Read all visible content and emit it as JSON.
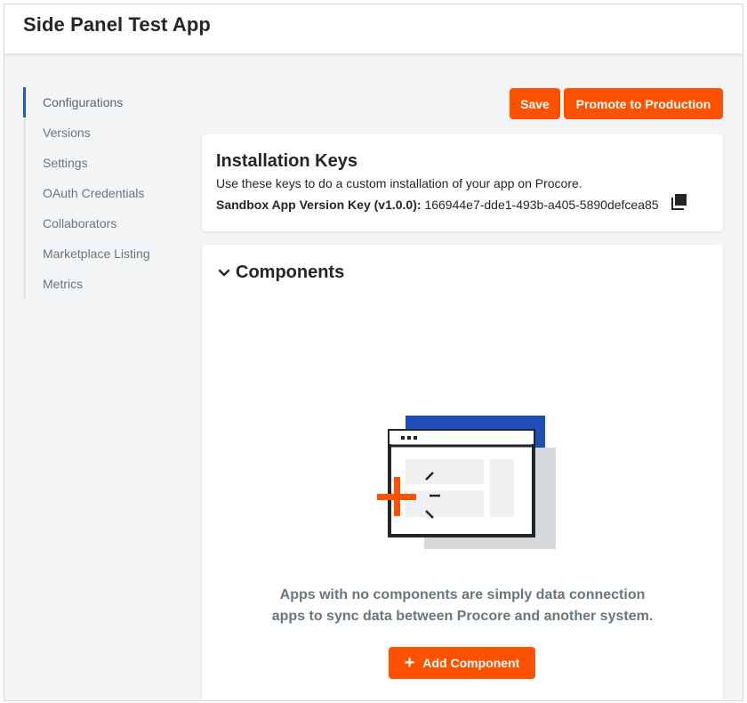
{
  "app": {
    "title": "Side Panel Test App"
  },
  "sidebar": {
    "items": [
      {
        "label": "Configurations",
        "active": true
      },
      {
        "label": "Versions"
      },
      {
        "label": "Settings"
      },
      {
        "label": "OAuth Credentials"
      },
      {
        "label": "Collaborators"
      },
      {
        "label": "Marketplace Listing"
      },
      {
        "label": "Metrics"
      }
    ]
  },
  "actions": {
    "save_label": "Save",
    "promote_label": "Promote to Production"
  },
  "installation_keys": {
    "title": "Installation Keys",
    "description": "Use these keys to do a custom installation of your app on Procore.",
    "key_label": "Sandbox App Version Key (v1.0.0):",
    "key_value": "166944e7-dde1-493b-a405-5890defcea85",
    "copy_icon": "copy-icon"
  },
  "components": {
    "title": "Components",
    "toggle_icon": "chevron-down-icon",
    "empty_line1": "Apps with no components are simply data connection",
    "empty_line2": "apps to sync data between Procore and another system.",
    "add_label": "Add Component",
    "add_icon": "plus-icon"
  },
  "colors": {
    "accent": "#ff5200",
    "active_nav": "#1f5bd6",
    "illustration_blue": "#1f4eb8"
  }
}
